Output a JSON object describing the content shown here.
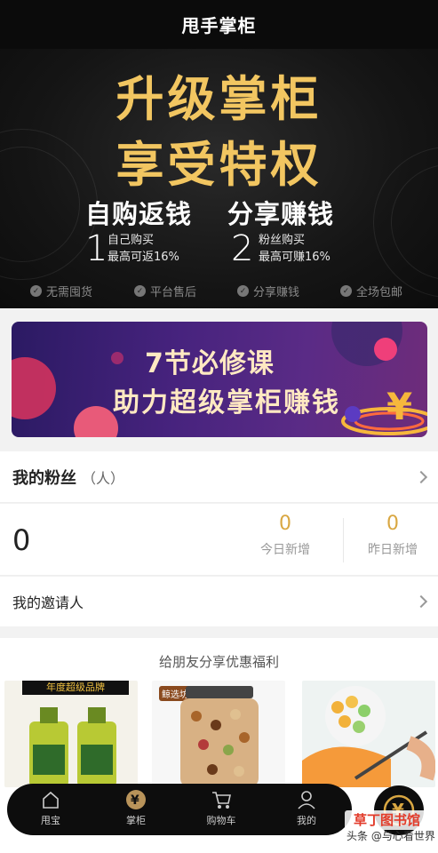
{
  "header": {
    "title": "甩手掌柜"
  },
  "hero": {
    "headline_line1": "升级掌柜",
    "headline_line2": "享受特权",
    "sub_left": "自购返钱",
    "sub_right": "分享赚钱",
    "item1": {
      "num": "1",
      "line1": "自己购买",
      "line2": "最高可返16%"
    },
    "item2": {
      "num": "2",
      "line1": "粉丝购买",
      "line2": "最高可赚16%"
    },
    "features": [
      "无需囤货",
      "平台售后",
      "分享赚钱",
      "全场包邮"
    ]
  },
  "banner": {
    "line1": "7节必修课",
    "line2": "助力超级掌柜赚钱"
  },
  "fans": {
    "title": "我的粉丝",
    "unit": "（人）",
    "total": "0",
    "today_value": "0",
    "today_label": "今日新增",
    "yesterday_value": "0",
    "yesterday_label": "昨日新增"
  },
  "inviter": {
    "label": "我的邀请人"
  },
  "share": {
    "title": "给朋友分享优惠福利",
    "products": [
      {
        "badge": "年度超级品牌",
        "icon": "oil-bottle-icon"
      },
      {
        "badge": "鲸选坊",
        "icon": "nut-jar-icon"
      },
      {
        "badge": "",
        "icon": "melon-baller-icon"
      }
    ]
  },
  "nav": {
    "items": [
      {
        "label": "甩宝",
        "icon": "home-icon"
      },
      {
        "label": "掌柜",
        "icon": "yen-icon"
      },
      {
        "label": "购物车",
        "icon": "cart-icon"
      },
      {
        "label": "我的",
        "icon": "user-icon"
      }
    ],
    "fab_icon": "yen-coin-icon"
  },
  "watermark": {
    "tag": "草丁图书馆",
    "text": "头条 @与心看世界"
  },
  "colors": {
    "gold": "#f2c661",
    "stat_gold": "#d9a742",
    "dark": "#0b0b0b"
  }
}
